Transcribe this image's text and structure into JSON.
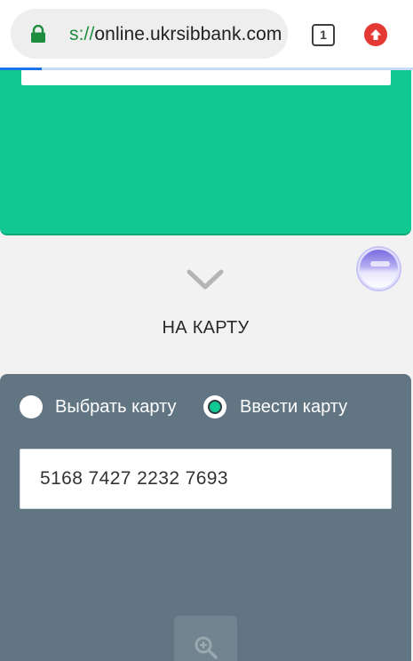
{
  "browser": {
    "url_scheme": "s://",
    "url_host": "online.ukrsibbank.com",
    "tab_count": "1",
    "icons": [
      "lock-icon",
      "tab-switcher-icon",
      "update-arrow-icon"
    ],
    "colors": {
      "secure": "#1e8e3e",
      "update": "#e53935",
      "progress": "#1a73e8"
    },
    "load_progress": 0.1
  },
  "main": {
    "section_label": "НА КАРТУ",
    "icons": [
      "chevron-down-icon",
      "floating-avatar"
    ],
    "colors": {
      "green_card": "#10c990",
      "panel": "#617583"
    }
  },
  "card_form": {
    "option_choose": "Выбрать карту",
    "option_enter": "Ввести карту",
    "selected_option": "Ввести карту",
    "card_number": "5168 7427 2232 7693",
    "icons": [
      "zoom-icon"
    ]
  }
}
